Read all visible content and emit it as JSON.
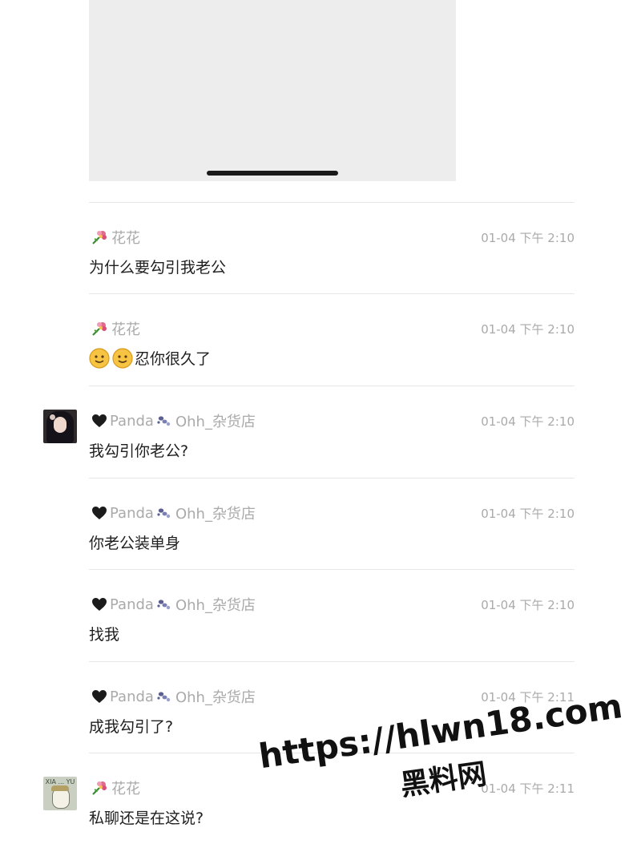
{
  "messages": [
    {
      "sender": "花花",
      "badge": "flower",
      "time": "01-04 下午 2:10",
      "text": "为什么要勾引我老公",
      "emoji_count": 0,
      "avatar": null
    },
    {
      "sender": "花花",
      "badge": "flower",
      "time": "01-04 下午 2:10",
      "text": "忍你很久了",
      "emoji_count": 2,
      "avatar": null
    },
    {
      "sender_prefix": "Panda",
      "sender_suffix": "Ohh_杂货店",
      "badge": "heart",
      "time": "01-04 下午 2:10",
      "text": "我勾引你老公?",
      "emoji_count": 0,
      "avatar": "girl-avatar"
    },
    {
      "sender_prefix": "Panda",
      "sender_suffix": "Ohh_杂货店",
      "badge": "heart",
      "time": "01-04 下午 2:10",
      "text": "你老公装单身",
      "emoji_count": 0,
      "avatar": null
    },
    {
      "sender_prefix": "Panda",
      "sender_suffix": "Ohh_杂货店",
      "badge": "heart",
      "time": "01-04 下午 2:10",
      "text": "找我",
      "emoji_count": 0,
      "avatar": null
    },
    {
      "sender_prefix": "Panda",
      "sender_suffix": "Ohh_杂货店",
      "badge": "heart",
      "time": "01-04 下午 2:11",
      "text": "成我勾引了?",
      "emoji_count": 0,
      "avatar": null
    },
    {
      "sender": "花花",
      "badge": "flower",
      "time": "01-04 下午 2:11",
      "text": "私聊还是在这说?",
      "emoji_count": 0,
      "avatar": "bear-avatar"
    }
  ],
  "bear_avatar_text": "XIA ... YU",
  "watermark": {
    "url": "https://hlwn18.com",
    "name": "黑料网"
  },
  "colors": {
    "meta_gray": "#aaaaaa",
    "text": "#1f1f1f",
    "divider": "#e6e6e6",
    "media_bg": "#ededed"
  }
}
